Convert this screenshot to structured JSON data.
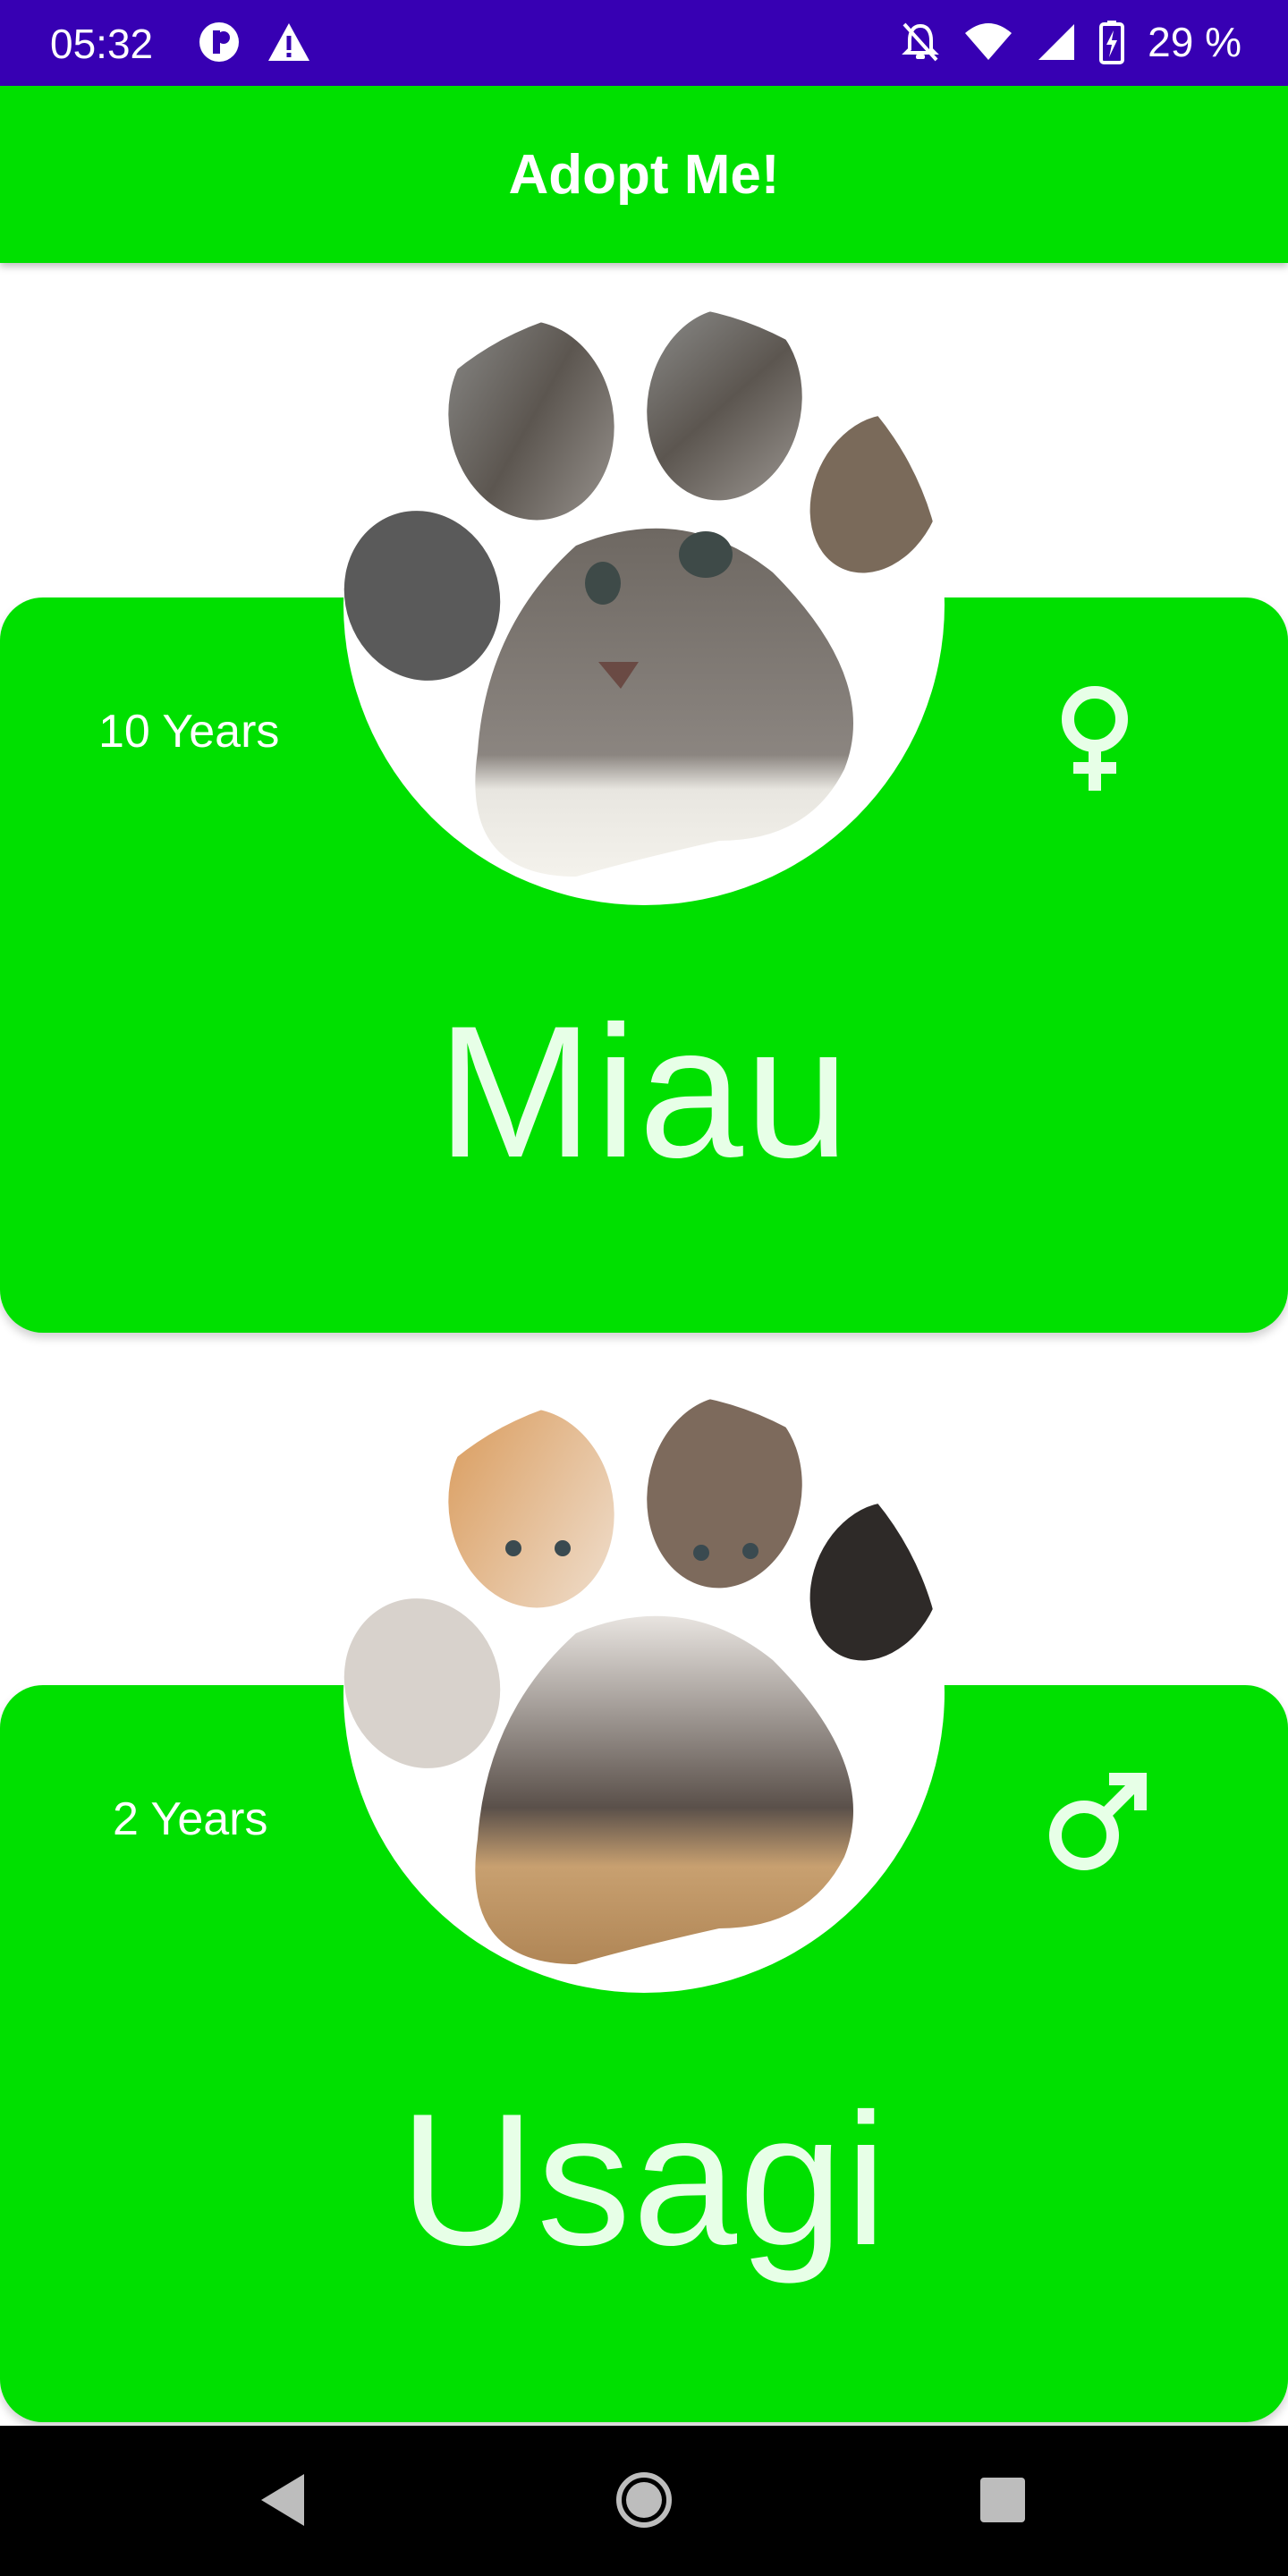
{
  "status_bar": {
    "time": "05:32",
    "battery": "29 %",
    "icons": [
      "circle-app-icon",
      "warning-icon",
      "muted-bell-icon",
      "wifi-icon",
      "cell-signal-icon",
      "battery-charging-icon"
    ]
  },
  "app_bar": {
    "title": "Adopt Me!"
  },
  "pets": [
    {
      "name": "Miau",
      "age": "10 Years",
      "gender_icon": "female-icon"
    },
    {
      "name": "Usagi",
      "age": "2 Years",
      "gender_icon": "male-icon"
    }
  ],
  "nav_bar": {
    "icons": [
      "back-icon",
      "home-icon",
      "recents-icon"
    ]
  },
  "colors": {
    "accent": "#00e000",
    "status_bar": "#3700b3",
    "name_text": "#e7ffe7"
  }
}
